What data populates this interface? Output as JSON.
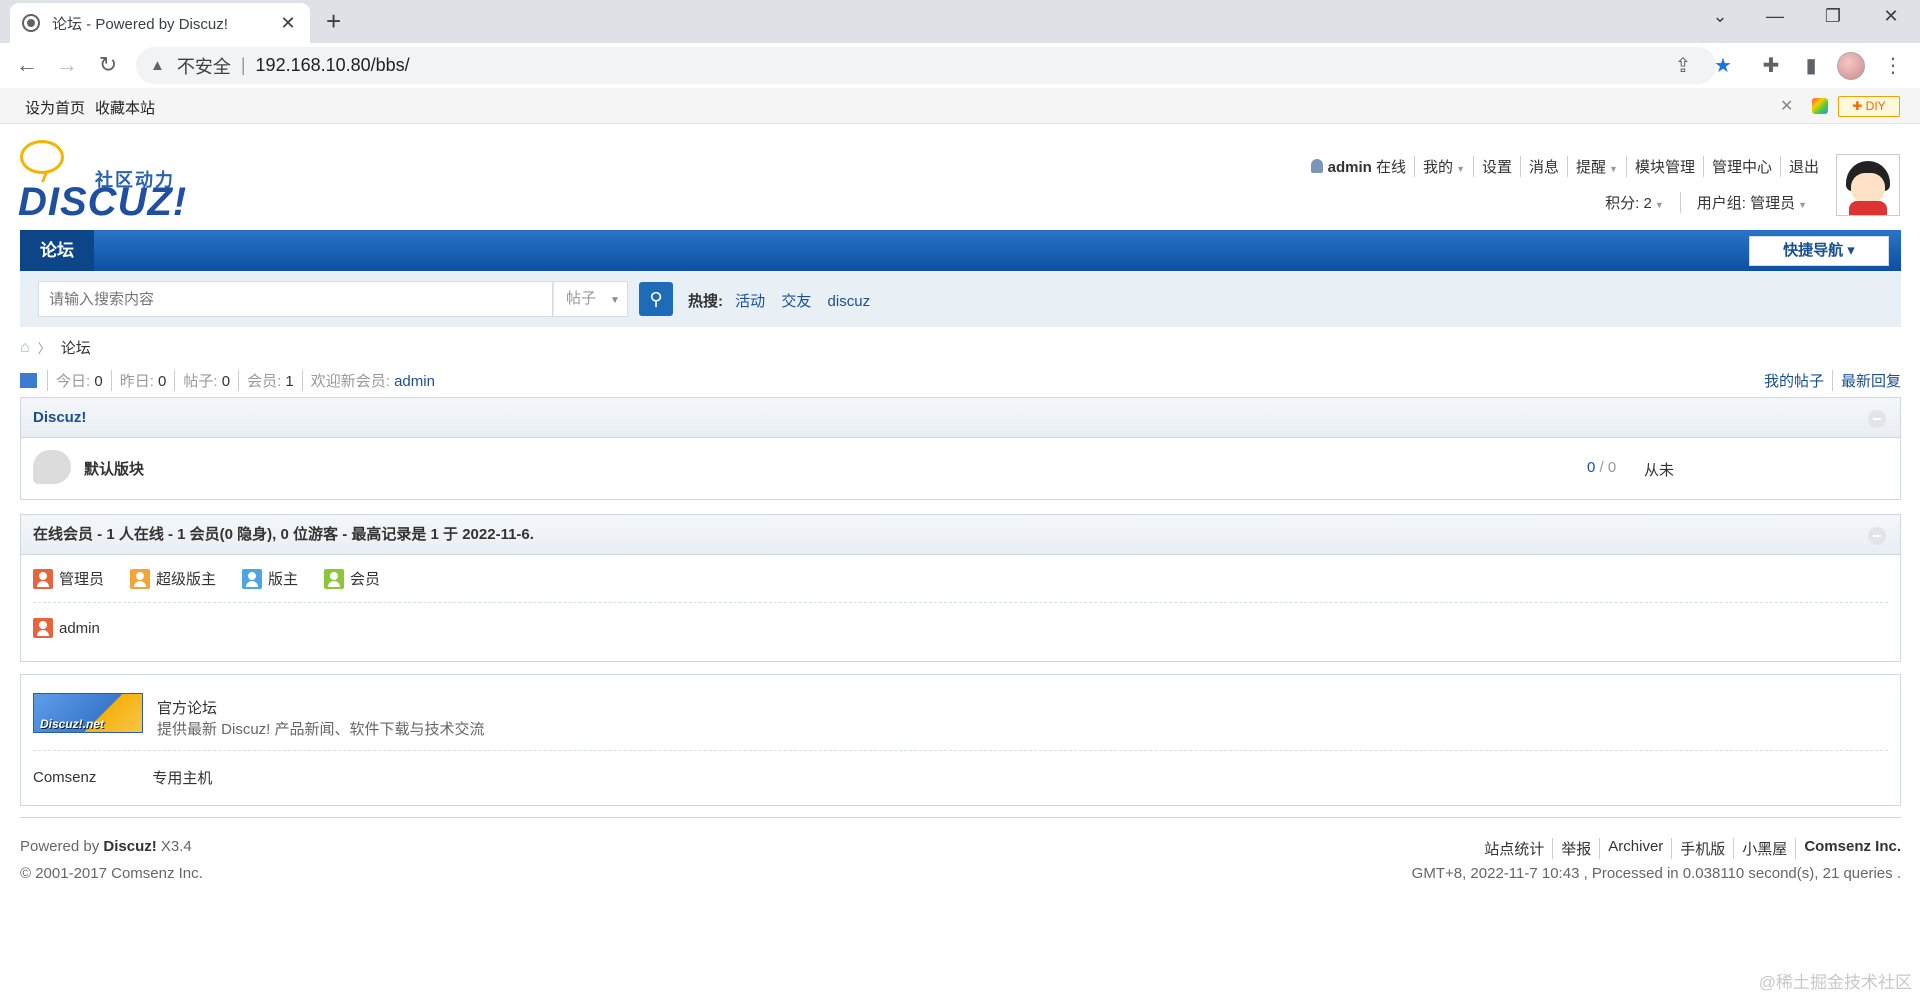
{
  "browser": {
    "tab_title": "论坛 - Powered by Discuz!",
    "tab_close": "✕",
    "new_tab": "+",
    "security_label": "不安全",
    "url": "192.168.10.80/bbs/"
  },
  "bookmarks": {
    "set_home": "设为首页",
    "add_favorite": "收藏本站"
  },
  "diy": {
    "label": "✚ DIY"
  },
  "logo": {
    "slogan": "社区动力",
    "text": "DISCUZ!"
  },
  "user": {
    "name": "admin",
    "status": "在线",
    "my": "我的",
    "settings": "设置",
    "messages": "消息",
    "reminders": "提醒",
    "block_manage": "模块管理",
    "admin_center": "管理中心",
    "logout": "退出",
    "points": "积分: 2",
    "user_group": "用户组: 管理员"
  },
  "nav": {
    "current": "论坛",
    "quick_nav": "快捷导航 ▾"
  },
  "search": {
    "placeholder": "请输入搜索内容",
    "type": "帖子",
    "hot_label": "热搜:",
    "hot_items": [
      "活动",
      "交友",
      "discuz"
    ]
  },
  "breadcrumb": {
    "current": "论坛"
  },
  "stats": {
    "today_label": "今日:",
    "today": "0",
    "yesterday_label": "昨日:",
    "yesterday": "0",
    "posts_label": "帖子:",
    "posts": "0",
    "members_label": "会员:",
    "members": "1",
    "welcome_label": "欢迎新会员:",
    "newest_member": "admin",
    "my_posts": "我的帖子",
    "latest_replies": "最新回复"
  },
  "category": {
    "title": "Discuz!",
    "forums": [
      {
        "name": "默认版块",
        "threads": "0",
        "posts": "0",
        "last_post": "从未"
      }
    ]
  },
  "online": {
    "title": "在线会员 - 1 人在线 - 1 会员(0 隐身), 0 位游客 - 最高记录是 1 于 2022-11-6.",
    "legend": [
      {
        "label": "管理员",
        "color": "#e8643c"
      },
      {
        "label": "超级版主",
        "color": "#f4a53a"
      },
      {
        "label": "版主",
        "color": "#4ea6e0"
      },
      {
        "label": "会员",
        "color": "#8cc63e"
      }
    ],
    "users": [
      {
        "name": "admin",
        "color": "#e8643c"
      }
    ]
  },
  "links": {
    "official_name": "官方论坛",
    "official_desc": "提供最新 Discuz! 产品新闻、软件下载与技术交流",
    "official_img_text": "Discuz!.net",
    "text_links": [
      "Comsenz",
      "专用主机"
    ]
  },
  "footer": {
    "powered_by": "Powered by",
    "brand": "Discuz!",
    "version": "X3.4",
    "copyright": "© 2001-2017 Comsenz Inc.",
    "links": [
      "站点统计",
      "举报",
      "Archiver",
      "手机版",
      "小黑屋",
      "Comsenz Inc."
    ],
    "runtime": "GMT+8, 2022-11-7 10:43 , Processed in 0.038110 second(s), 21 queries ."
  },
  "watermark": "@稀土掘金技术社区"
}
